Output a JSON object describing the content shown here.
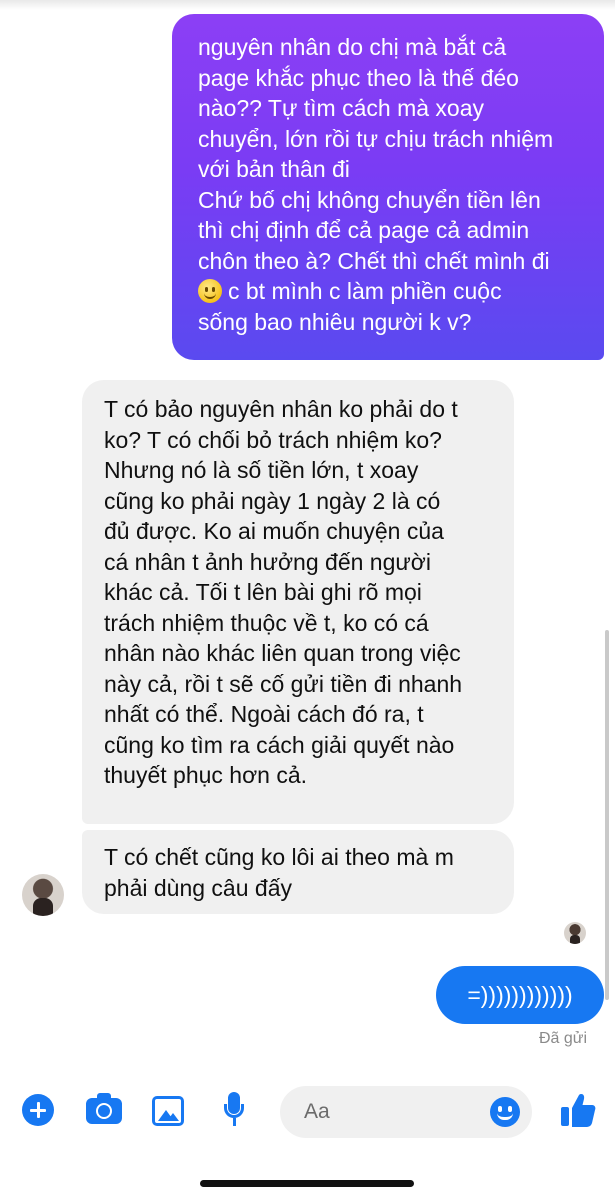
{
  "conversation": {
    "messages": [
      {
        "direction": "outgoing",
        "lines": [
          "nguyên nhân do chị mà bắt cả",
          "page khắc phục theo là thế đéo",
          "nào?? Tự tìm cách mà xoay",
          "chuyển, lớn rồi tự chịu trách nhiệm",
          "với bản thân đi",
          "Chứ bố chị không chuyển tiền lên",
          "thì chị định để cả page cả admin",
          "chôn theo à? Chết thì chết mình đi",
          "c bt mình c làm phiền cuộc",
          "sống bao nhiêu người k v?"
        ],
        "inline_emoji": "slightly-smiling-face"
      },
      {
        "direction": "incoming",
        "lines": [
          "T có bảo nguyên nhân ko phải do t",
          "ko? T có chối bỏ trách nhiệm ko?",
          "Nhưng nó là số tiền lớn, t xoay",
          "cũng ko phải ngày 1 ngày 2 là có",
          "đủ được. Ko ai muốn chuyện của",
          "cá nhân t ảnh hưởng đến người",
          "khác cả. Tối t lên bài ghi rõ mọi",
          "trách nhiệm thuộc về t, ko có cá",
          "nhân nào khác liên quan trong việc",
          "này cả, rồi t sẽ cố gửi tiền đi nhanh",
          "nhất có thể. Ngoài cách đó ra, t",
          "cũng ko tìm ra cách giải quyết nào",
          "thuyết phục hơn cả."
        ]
      },
      {
        "direction": "incoming",
        "lines": [
          "T có chết cũng ko lôi ai theo mà m",
          "phải dùng câu đấy"
        ]
      },
      {
        "direction": "outgoing",
        "text": "=))))))))))))"
      }
    ],
    "status": "Đã gửi"
  },
  "composer": {
    "placeholder": "Aa",
    "icons": [
      "plus-icon",
      "camera-icon",
      "photo-icon",
      "microphone-icon",
      "emoji-icon",
      "thumbs-up-icon"
    ]
  },
  "colors": {
    "outgoing_gradient_top": "#8c3ff5",
    "outgoing_gradient_bottom": "#5a4af0",
    "outgoing_blue": "#1778f2",
    "incoming_bg": "#f0f0f0",
    "accent": "#1778f2"
  }
}
